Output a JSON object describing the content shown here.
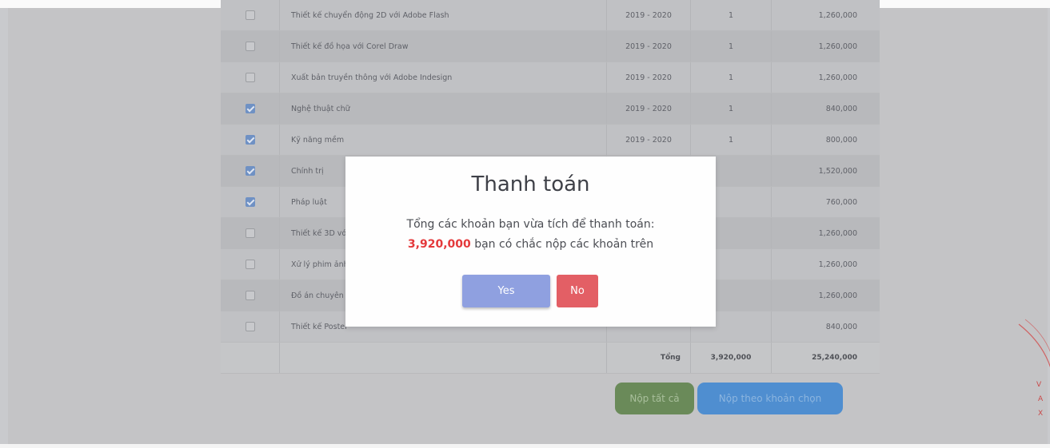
{
  "fees": {
    "rows": [
      {
        "name": "Thiết kế chuyển động 2D với Adobe Flash",
        "year": "2019 - 2020",
        "qty": "1",
        "amount": "1,260,000",
        "checked": false
      },
      {
        "name": "Thiết kế đồ họa với Corel Draw",
        "year": "2019 - 2020",
        "qty": "1",
        "amount": "1,260,000",
        "checked": false
      },
      {
        "name": "Xuất bản truyền thông với Adobe Indesign",
        "year": "2019 - 2020",
        "qty": "1",
        "amount": "1,260,000",
        "checked": false
      },
      {
        "name": "Nghệ thuật chữ",
        "year": "2019 - 2020",
        "qty": "1",
        "amount": "840,000",
        "checked": true
      },
      {
        "name": "Kỹ năng mềm",
        "year": "2019 - 2020",
        "qty": "1",
        "amount": "800,000",
        "checked": true
      },
      {
        "name": "Chính trị",
        "year": "",
        "qty": "",
        "amount": "1,520,000",
        "checked": true
      },
      {
        "name": "Pháp luật",
        "year": "",
        "qty": "",
        "amount": "760,000",
        "checked": true
      },
      {
        "name": "Thiết kế 3D với",
        "year": "",
        "qty": "",
        "amount": "1,260,000",
        "checked": false
      },
      {
        "name": "Xử lý phim ảnh",
        "year": "",
        "qty": "",
        "amount": "1,260,000",
        "checked": false
      },
      {
        "name": "Đồ án chuyên",
        "year": "",
        "qty": "",
        "amount": "1,260,000",
        "checked": false
      },
      {
        "name": "Thiết kế Poster",
        "year": "",
        "qty": "",
        "amount": "840,000",
        "checked": false
      }
    ],
    "total": {
      "label": "Tổng",
      "selected": "3,920,000",
      "all": "25,240,000"
    }
  },
  "actions": {
    "pay_all": "Nộp tất cả",
    "pay_selected": "Nộp theo khoản chọn"
  },
  "dialog": {
    "title": "Thanh toán",
    "message": "Tổng các khoản bạn vừa tích để thanh toán:",
    "amount": "3,920,000",
    "confirm_text": "bạn có chắc nộp các khoản trên",
    "yes": "Yes",
    "no": "No"
  },
  "stamp": {
    "text": "V A X"
  },
  "colors": {
    "amount_red": "#e4393b",
    "yes_blue": "#8fa0e0",
    "no_red": "#e35f65",
    "pay_all_green": "#6a8a59",
    "pay_selected_blue": "#4f8ed0"
  }
}
